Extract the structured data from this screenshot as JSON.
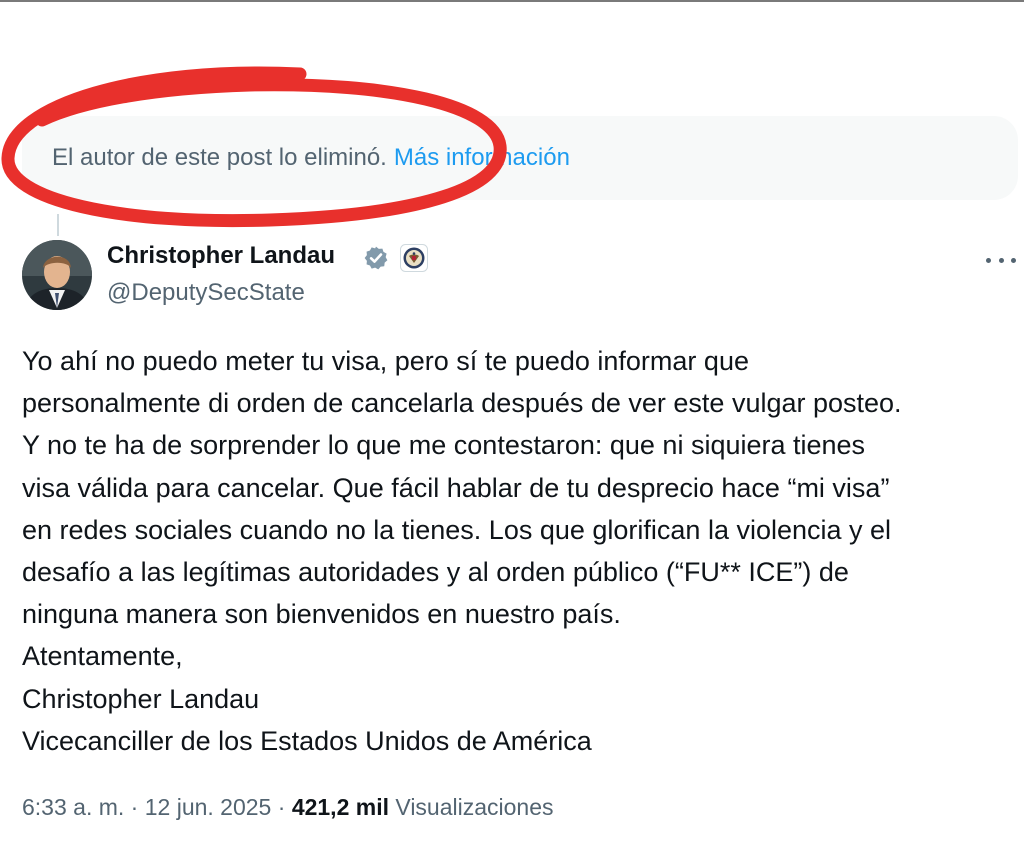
{
  "deleted_notice": {
    "message": "El autor de este post lo eliminó.",
    "link_label": "Más información"
  },
  "author": {
    "name": "Christopher Landau",
    "handle": "@DeputySecState",
    "verified_icon": "verified-badge-icon",
    "affiliation_icon": "us-state-department-seal-icon"
  },
  "post": {
    "text": "Yo ahí no puedo meter tu visa, pero sí te puedo informar que\npersonalmente di orden de cancelarla después de ver este vulgar posteo.\nY no te ha de sorprender lo que me contestaron: que ni siquiera tienes\nvisa válida para cancelar. Que fácil hablar de tu desprecio hace “mi visa”\nen redes sociales cuando no la tienes. Los que glorifican la violencia y el\ndesafío a las legítimas autoridades y al orden público (“FU** ICE”) de\nninguna manera son bienvenidos en nuestro país.\nAtentamente,\nChristopher Landau\nVicecanciller de los Estados Unidos de América"
  },
  "meta": {
    "time": "6:33 a. m.",
    "separator": " · ",
    "date": "12 jun. 2025",
    "views_count": "421,2 mil",
    "views_label": "Visualizaciones"
  },
  "colors": {
    "link": "#1d9bf0",
    "secondary_text": "#536471",
    "primary_text": "#0f1419",
    "annotation_red": "#e8302c",
    "verified_badge": "#829aab"
  }
}
